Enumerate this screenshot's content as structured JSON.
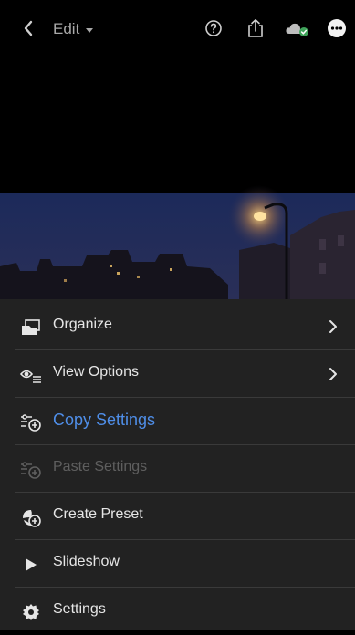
{
  "header": {
    "back_icon": "chevron-left-icon",
    "mode_label": "Edit",
    "icons": [
      "help-icon",
      "share-icon",
      "cloud-sync-icon",
      "more-icon"
    ]
  },
  "menu": {
    "items": [
      {
        "label": "Organize",
        "icon": "organize-icon",
        "has_arrow": true
      },
      {
        "label": "View Options",
        "icon": "view-options-icon",
        "has_arrow": true
      },
      {
        "label": "Copy Settings",
        "icon": "copy-settings-icon",
        "highlighted": true
      },
      {
        "label": "Paste Settings",
        "icon": "paste-settings-icon",
        "disabled": true
      },
      {
        "label": "Create Preset",
        "icon": "create-preset-icon"
      },
      {
        "label": "Slideshow",
        "icon": "play-icon"
      },
      {
        "label": "Settings",
        "icon": "gear-icon"
      }
    ]
  },
  "colors": {
    "accent": "#4f8ee8",
    "menu_bg": "#222222",
    "disabled_text": "#5f5f5f",
    "cloud_status": "#3fa35a"
  }
}
